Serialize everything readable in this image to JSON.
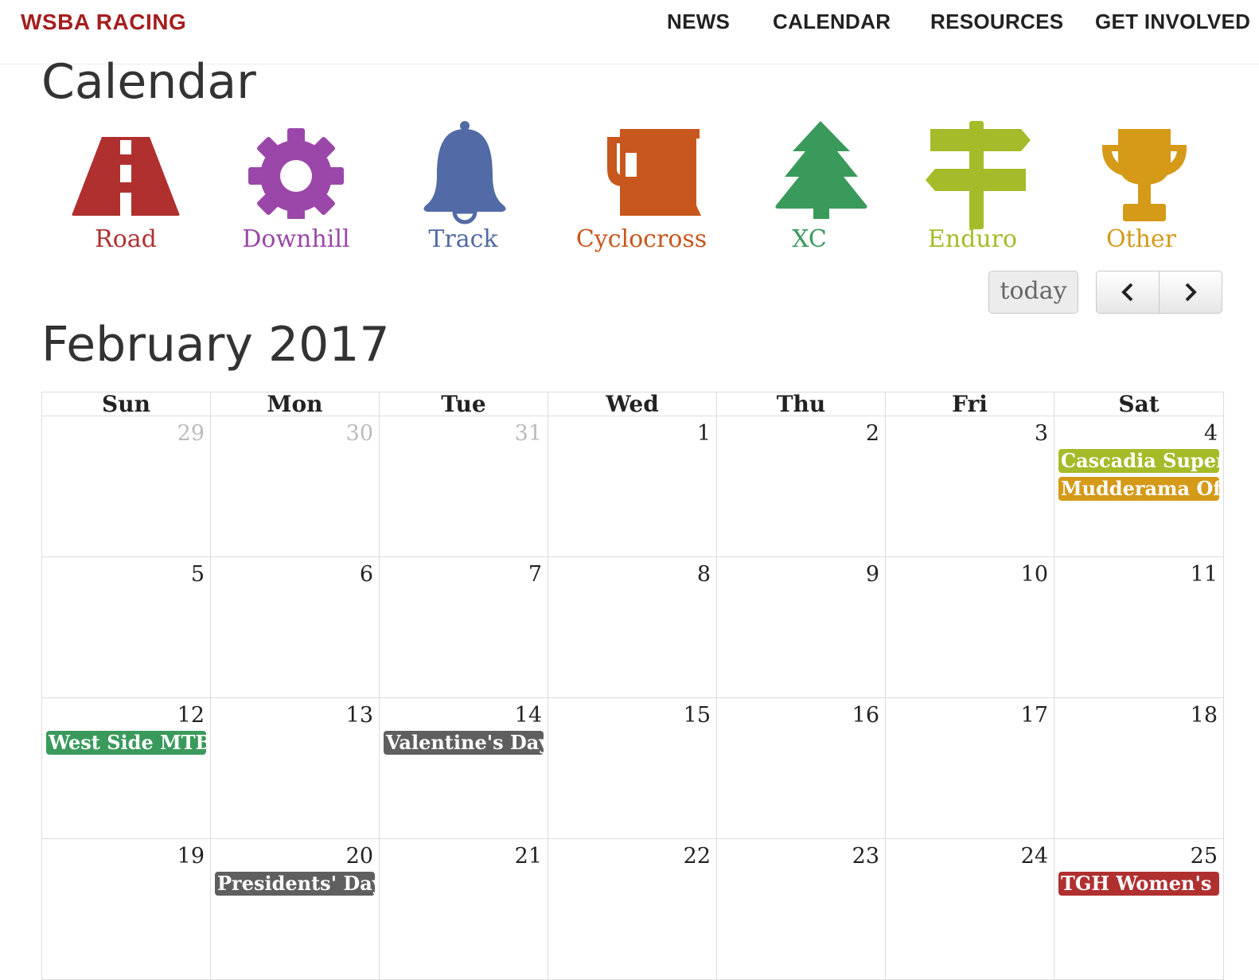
{
  "brand": "WSBA RACING",
  "nav": [
    {
      "label": "NEWS"
    },
    {
      "label": "CALENDAR"
    },
    {
      "label": "RESOURCES"
    },
    {
      "label": "GET INVOLVED"
    }
  ],
  "page_title": "Calendar",
  "categories": [
    {
      "label": "Road",
      "icon": "road-icon",
      "color": "#b03030"
    },
    {
      "label": "Downhill",
      "icon": "gear-icon",
      "color": "#9b47a9"
    },
    {
      "label": "Track",
      "icon": "bell-icon",
      "color": "#526aa6"
    },
    {
      "label": "Cyclocross",
      "icon": "beer-mug-icon",
      "color": "#c8571e"
    },
    {
      "label": "XC",
      "icon": "tree-icon",
      "color": "#3a9a5c"
    },
    {
      "label": "Enduro",
      "icon": "signpost-icon",
      "color": "#a6bb2a"
    },
    {
      "label": "Other",
      "icon": "trophy-icon",
      "color": "#d49a18"
    }
  ],
  "toolbar": {
    "today": "today",
    "prev": "‹",
    "next": "›"
  },
  "month_title": "February 2017",
  "weekdays": [
    "Sun",
    "Mon",
    "Tue",
    "Wed",
    "Thu",
    "Fri",
    "Sat"
  ],
  "weeks": [
    [
      {
        "n": "29",
        "other": true
      },
      {
        "n": "30",
        "other": true
      },
      {
        "n": "31",
        "other": true
      },
      {
        "n": "1"
      },
      {
        "n": "2"
      },
      {
        "n": "3"
      },
      {
        "n": "4",
        "events": [
          {
            "title": "Cascadia Super Cross",
            "color": "#a6bb2a"
          },
          {
            "title": "Mudderama Off Road",
            "color": "#d49a18"
          }
        ]
      }
    ],
    [
      {
        "n": "5"
      },
      {
        "n": "6"
      },
      {
        "n": "7"
      },
      {
        "n": "8"
      },
      {
        "n": "9"
      },
      {
        "n": "10"
      },
      {
        "n": "11"
      }
    ],
    [
      {
        "n": "12",
        "events": [
          {
            "title": "West Side MTB Series",
            "color": "#3a9a5c"
          }
        ]
      },
      {
        "n": "13"
      },
      {
        "n": "14",
        "events": [
          {
            "title": "Valentine's Day",
            "color": "#5f5f5f"
          }
        ]
      },
      {
        "n": "15"
      },
      {
        "n": "16"
      },
      {
        "n": "17"
      },
      {
        "n": "18"
      }
    ],
    [
      {
        "n": "19"
      },
      {
        "n": "20",
        "events": [
          {
            "title": "Presidents' Day",
            "color": "#5f5f5f"
          }
        ]
      },
      {
        "n": "21"
      },
      {
        "n": "22"
      },
      {
        "n": "23"
      },
      {
        "n": "24"
      },
      {
        "n": "25",
        "events": [
          {
            "title": "TGH Women's Invitational",
            "color": "#b03030"
          }
        ]
      }
    ]
  ]
}
